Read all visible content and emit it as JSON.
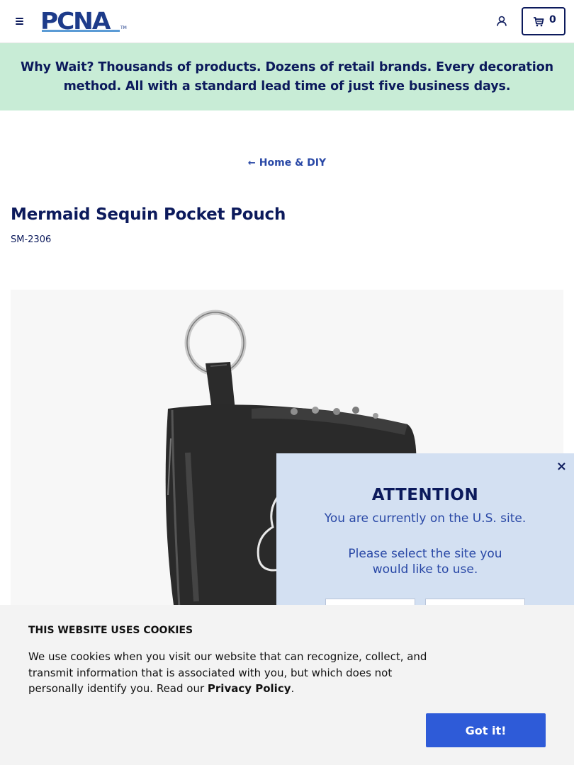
{
  "header": {
    "logo_text": "PCNA",
    "logo_tm": "TM",
    "cart_count": "0",
    "menu_icon": "hamburger-menu-icon",
    "account_icon": "user-account-icon",
    "cart_icon": "shopping-cart-icon"
  },
  "promo": {
    "text": "Why Wait? Thousands of products. Dozens of retail brands. Every decoration method. All with a standard lead time of just five business days."
  },
  "breadcrumb": {
    "arrow": "←",
    "label": "Home & DIY"
  },
  "product": {
    "title": "Mermaid Sequin Pocket Pouch",
    "sku": "SM-2306"
  },
  "attention": {
    "close": "×",
    "title": "ATTENTION",
    "message": "You are currently on the U.S. site.",
    "prompt": "Please select the site you would like to use."
  },
  "cookie": {
    "title": "THIS WEBSITE USES COOKIES",
    "text": "We use cookies when you visit our website that can recognize, collect, and transmit information that is associated with you, but which does not personally identify you. Read our ",
    "link_label": "Privacy Policy",
    "text_end": ".",
    "button_label": "Got it!"
  },
  "colors": {
    "brand_navy": "#0c1a5c",
    "promo_bg": "#c8ecd6",
    "attention_bg": "#d3e0f2",
    "cookie_button": "#2e5bd8"
  }
}
